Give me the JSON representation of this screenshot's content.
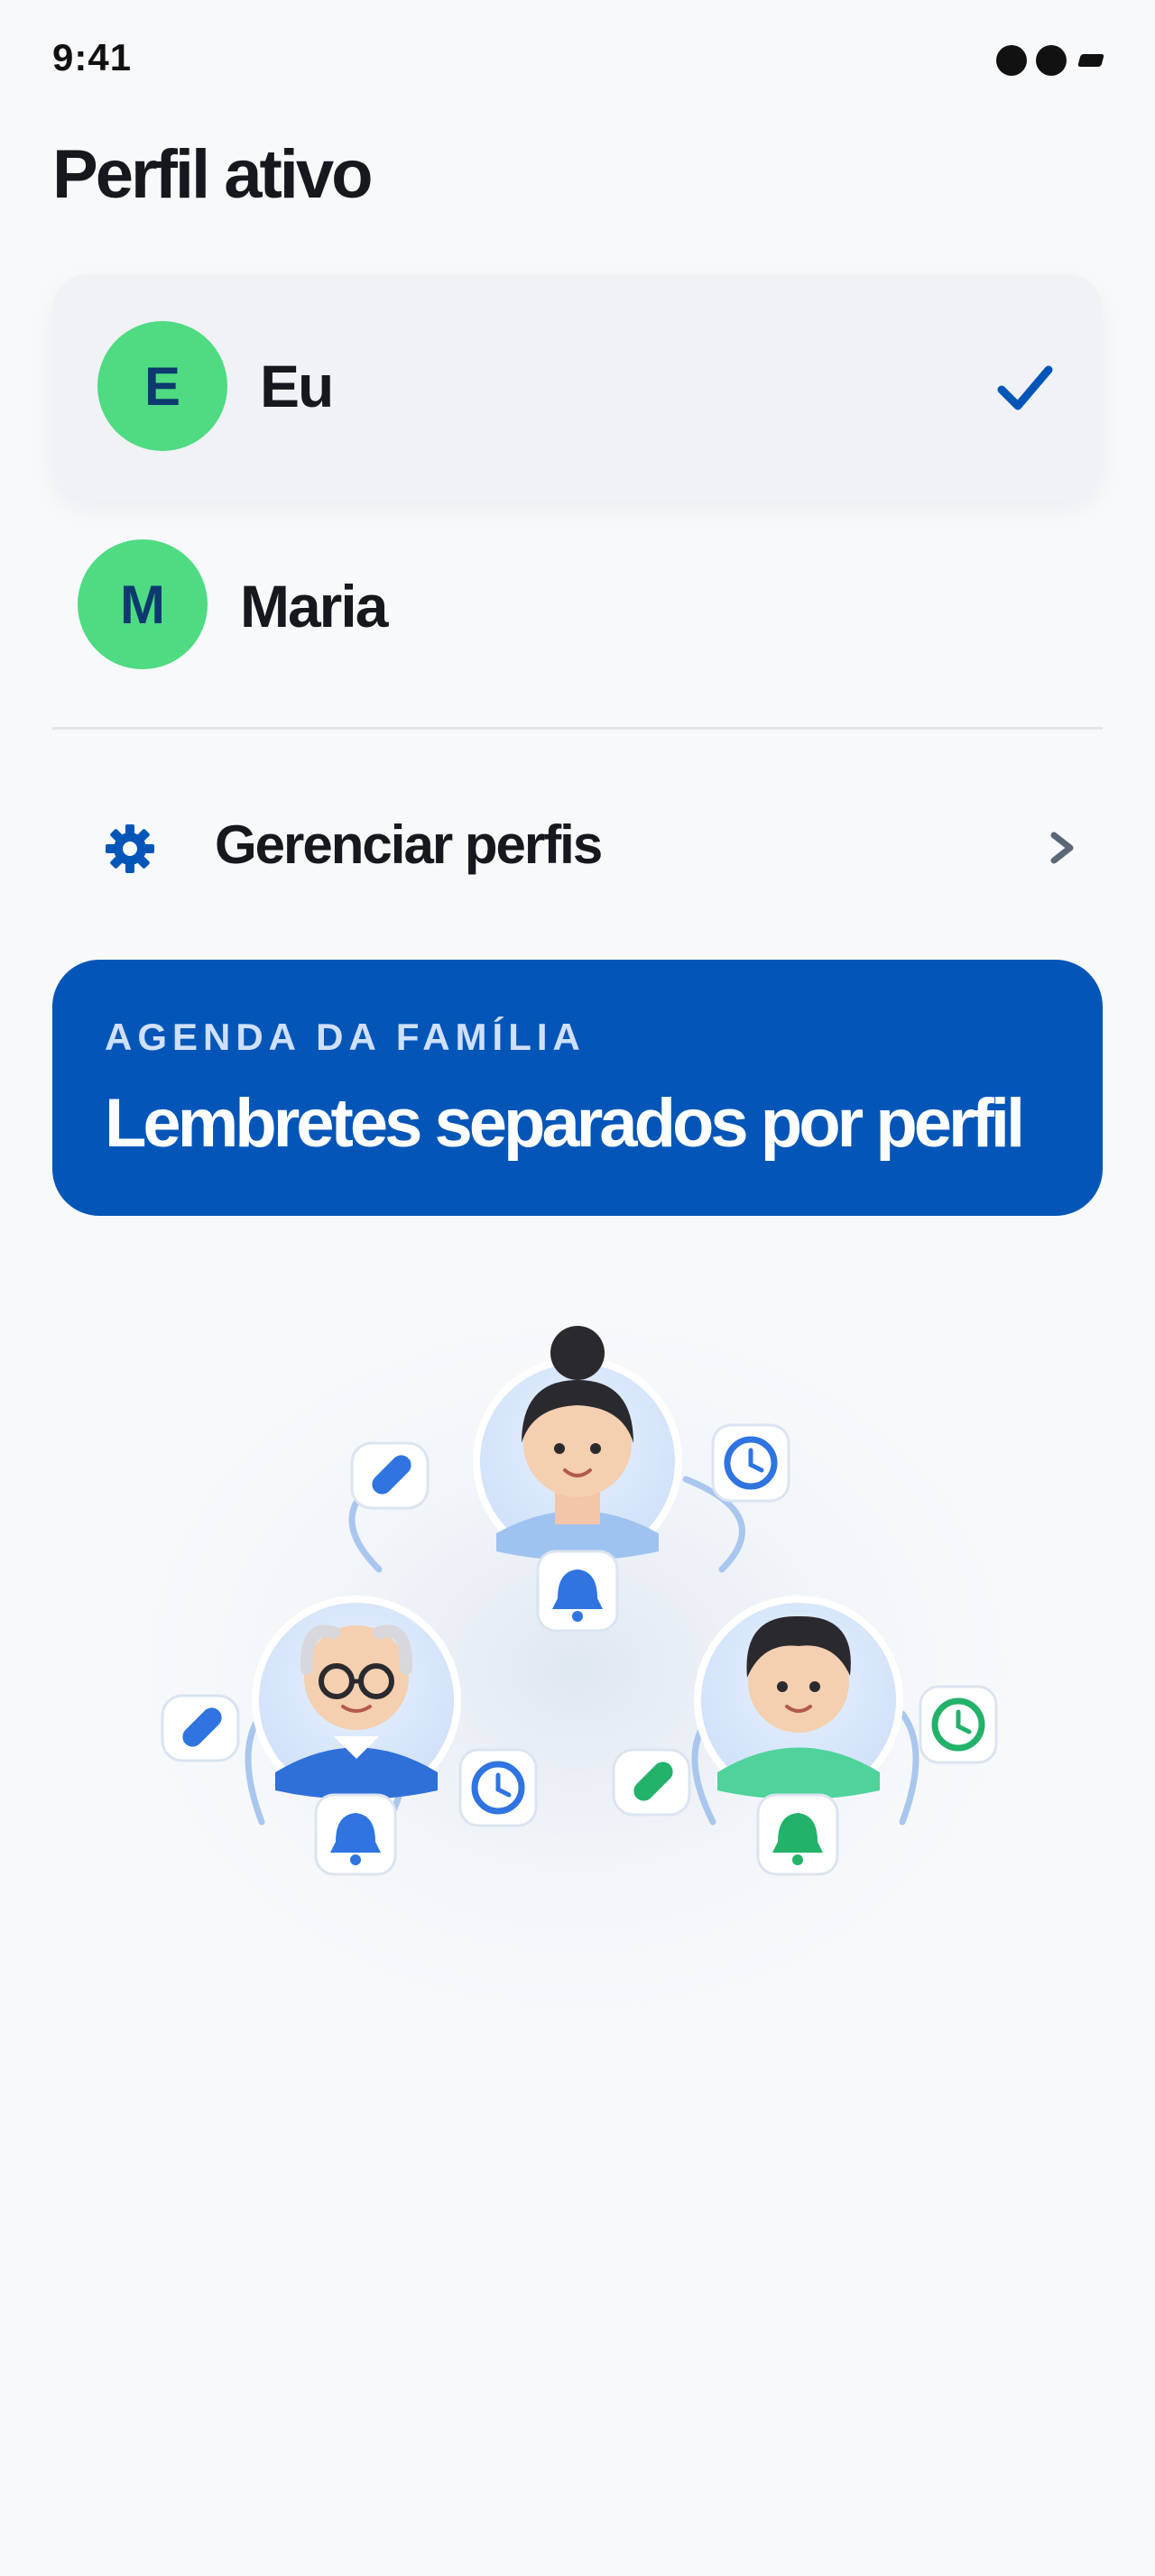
{
  "status_bar": {
    "time": "9:41"
  },
  "page_title": "Perfil ativo",
  "profiles": [
    {
      "initial": "E",
      "name": "Eu",
      "selected": true
    },
    {
      "initial": "M",
      "name": "Maria",
      "selected": false
    }
  ],
  "manage": {
    "label": "Gerenciar perfis",
    "icon": "gear-icon"
  },
  "banner": {
    "eyebrow": "AGENDA DA FAMÍLIA",
    "title": "Lembretes separados por perfil"
  },
  "illustration": {
    "members": [
      "woman-avatar",
      "grandfather-avatar",
      "boy-avatar"
    ],
    "icons": [
      "bell-icon",
      "pill-icon",
      "clock-icon"
    ]
  },
  "colors": {
    "accent": "#0356b8",
    "avatar_bg": "#4edb82",
    "avatar_text": "#0d3a6e",
    "background": "#f7f9fb"
  }
}
